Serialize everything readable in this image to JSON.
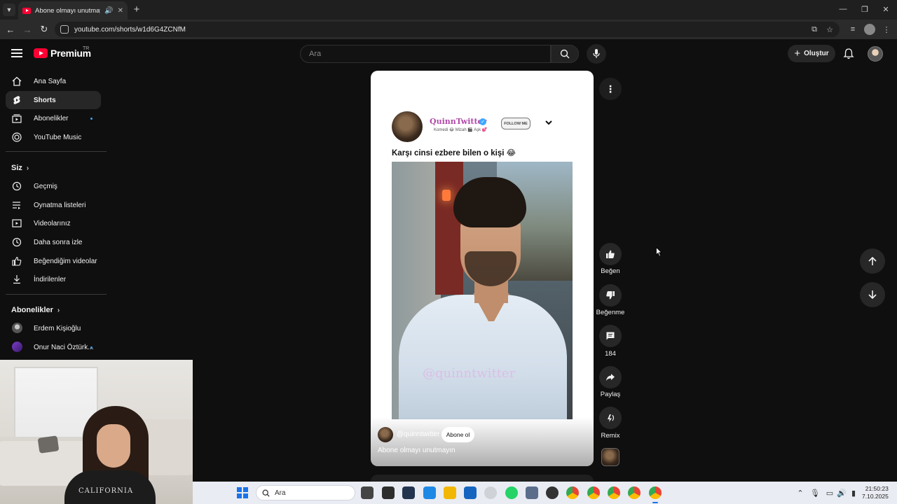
{
  "browser": {
    "tab_title": "Abone olmayı unutmayın",
    "url": "youtube.com/shorts/w1d6G4ZCNfM"
  },
  "header": {
    "logo_text": "Premium",
    "country_code": "TR",
    "search_placeholder": "Ara",
    "create_label": "Oluştur"
  },
  "sidebar": {
    "main": [
      {
        "label": "Ana Sayfa",
        "icon": "home-icon"
      },
      {
        "label": "Shorts",
        "icon": "shorts-icon"
      },
      {
        "label": "Abonelikler",
        "icon": "subscriptions-icon"
      },
      {
        "label": "YouTube Music",
        "icon": "youtube-music-icon"
      }
    ],
    "you_heading": "Siz",
    "you": [
      {
        "label": "Geçmiş",
        "icon": "history-icon"
      },
      {
        "label": "Oynatma listeleri",
        "icon": "playlists-icon"
      },
      {
        "label": "Videolarınız",
        "icon": "your-videos-icon"
      },
      {
        "label": "Daha sonra izle",
        "icon": "watch-later-icon"
      },
      {
        "label": "Beğendiğim videolar",
        "icon": "liked-videos-icon"
      },
      {
        "label": "İndirilenler",
        "icon": "downloads-icon"
      }
    ],
    "subs_heading": "Abonelikler",
    "subs": [
      {
        "label": "Erdem Kişioğlu"
      },
      {
        "label": "Onur Naci Öztürk..."
      }
    ]
  },
  "short": {
    "embedded_channel_name": "QuinnTwitter",
    "embedded_channel_sub": "Komedi 😂 Mizah 🎬 Aşk 💕",
    "embedded_follow": "FOLLOW ME",
    "caption": "Karşı cinsi ezbere bilen o kişi 😂",
    "watermark": "@quinntwitter",
    "handle": "@quinntwitter",
    "subscribe_label": "Abone ol",
    "title": "Abone olmayı unutmayın"
  },
  "actions": {
    "like_label": "Beğen",
    "dislike_label": "Beğenme",
    "comment_count": "184",
    "share_label": "Paylaş",
    "remix_label": "Remix"
  },
  "webcam": {
    "shirt_text": "CALIFORNIA"
  },
  "taskbar": {
    "search_placeholder": "Ara",
    "time": "21:50:23",
    "date": "7.10.2025"
  }
}
